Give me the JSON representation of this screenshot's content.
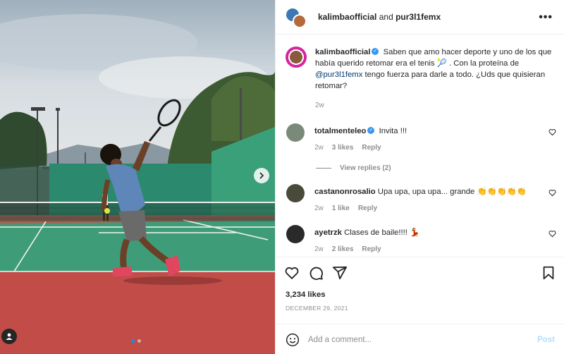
{
  "post": {
    "header": {
      "author": "kalimbaofficial",
      "conjunction": "and",
      "collaborator": "pur3l1femx"
    },
    "caption": {
      "author": "kalimbaofficial",
      "text_before": "Saben que amo hacer deporte y uno de los que había querido retomar era el tenis",
      "tennis_emoji": "🎾",
      "text_middle": ". Con la proteína de",
      "mention": "@pur3l1femx",
      "text_after": "tengo fuerza para darle a todo. ¿Uds que quisieran retomar?",
      "time": "2w"
    },
    "comments": [
      {
        "user": "totalmenteleo",
        "verified": true,
        "text": "Invita !!!",
        "time": "2w",
        "likes": "3 likes",
        "reply_label": "Reply",
        "view_replies": "View replies (2)",
        "avatar_color": "#7a8a7a"
      },
      {
        "user": "castanonrosalio",
        "verified": false,
        "text": "Upa upa, upa upa... grande",
        "emoji": "👏👏👏👏👏",
        "time": "2w",
        "likes": "1 like",
        "reply_label": "Reply",
        "avatar_color": "#4a4a3a"
      },
      {
        "user": "ayetrzk",
        "verified": false,
        "text": "Clases de baile!!!!",
        "emoji": "💃",
        "time": "2w",
        "likes": "2 likes",
        "reply_label": "Reply",
        "avatar_color": "#2a2a2a"
      }
    ],
    "likes": "3,234 likes",
    "date": "DECEMBER 29, 2021",
    "add_comment": {
      "placeholder": "Add a comment...",
      "post_label": "Post"
    },
    "carousel": {
      "total": 2,
      "current": 1
    },
    "colors": {
      "accent": "#0095f6",
      "verified": "#3897f0",
      "post_disabled": "#b2dffc"
    },
    "icons": [
      "more-icon",
      "heart-icon",
      "comment-icon",
      "share-icon",
      "bookmark-icon",
      "emoji-icon",
      "chevron-right-icon",
      "user-tag-icon"
    ]
  }
}
